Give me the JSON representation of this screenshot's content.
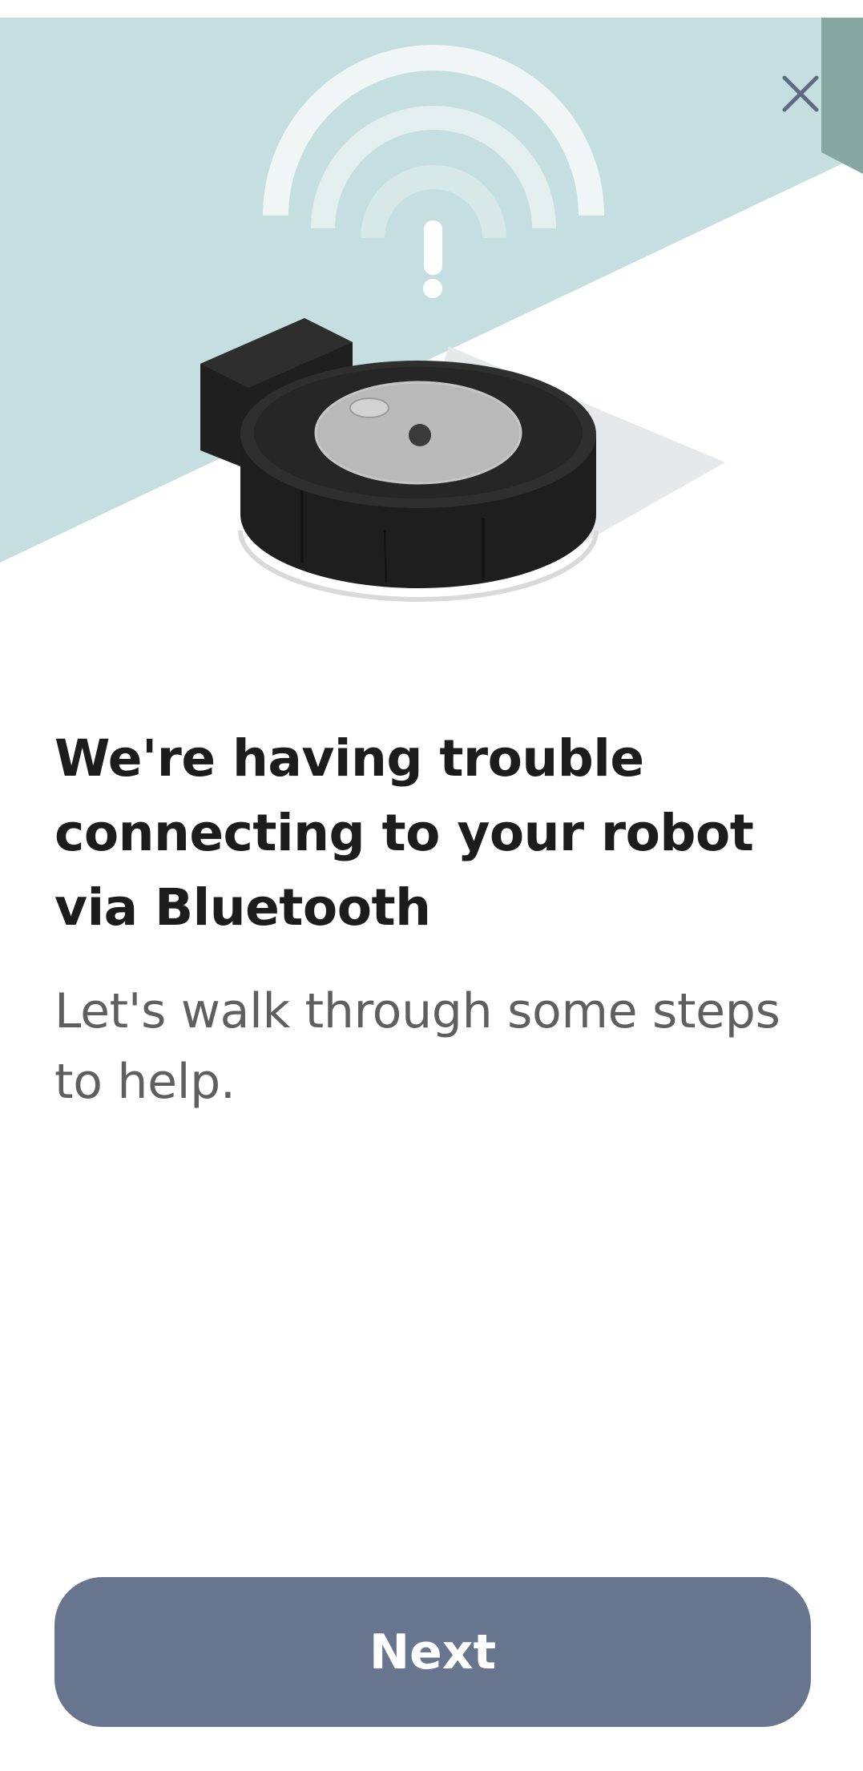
{
  "hero": {
    "background_color": "#c5dfe0",
    "accent_color": "#86a8a0",
    "illustration_icons": [
      "wifi-signal-icon",
      "alert-exclamation-icon",
      "robot-vacuum-illustration"
    ]
  },
  "close_button": {
    "icon": "close-icon",
    "color": "#5e6a80"
  },
  "content": {
    "title": "We're having trouble connecting to your robot via Bluetooth",
    "subtitle": "Let's walk through some steps to help."
  },
  "footer": {
    "next_label": "Next",
    "button_color": "#67758f"
  }
}
